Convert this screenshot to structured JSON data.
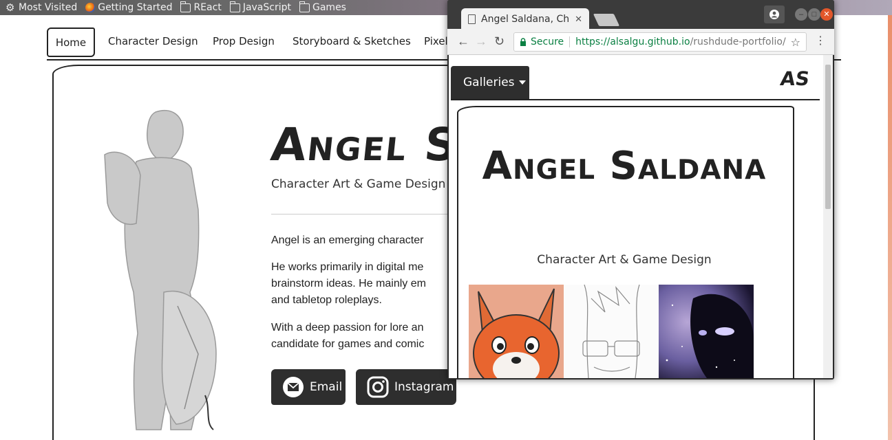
{
  "bookmarks_bar": {
    "items": [
      {
        "label": "Most Visited",
        "icon": "gear-icon"
      },
      {
        "label": "Getting Started",
        "icon": "firefox-icon"
      },
      {
        "label": "REact",
        "icon": "folder-icon"
      },
      {
        "label": "JavaScript",
        "icon": "folder-icon"
      },
      {
        "label": "Games",
        "icon": "folder-icon"
      }
    ]
  },
  "background_page": {
    "nav": [
      "Home",
      "Character Design",
      "Prop Design",
      "Storyboard & Sketches",
      "Pixel"
    ],
    "name": "Angel S",
    "subtitle": "Character Art & Game Design",
    "para1": "Angel is an emerging character",
    "para2": [
      "He works primarily in digital me",
      "brainstorm ideas. He mainly em",
      "and tabletop roleplays."
    ],
    "para3": [
      "With a deep passion for lore an",
      "candidate for games and comic"
    ],
    "email_label": "Email",
    "instagram_label": "Instagram"
  },
  "chrome": {
    "tab_title": "Angel Saldana, Cha",
    "secure_label": "Secure",
    "url_host": "https://alsalgu.github.io",
    "url_path": "/rushdude-portfolio/"
  },
  "mobile_page": {
    "galleries_label": "Galleries",
    "brand": "AS",
    "name": "Angel Saldana",
    "subtitle": "Character Art & Game Design"
  },
  "colors": {
    "dark_button": "#2e2e2e",
    "secure_green": "#0b8043",
    "accent_strip": "#e98f6a"
  }
}
